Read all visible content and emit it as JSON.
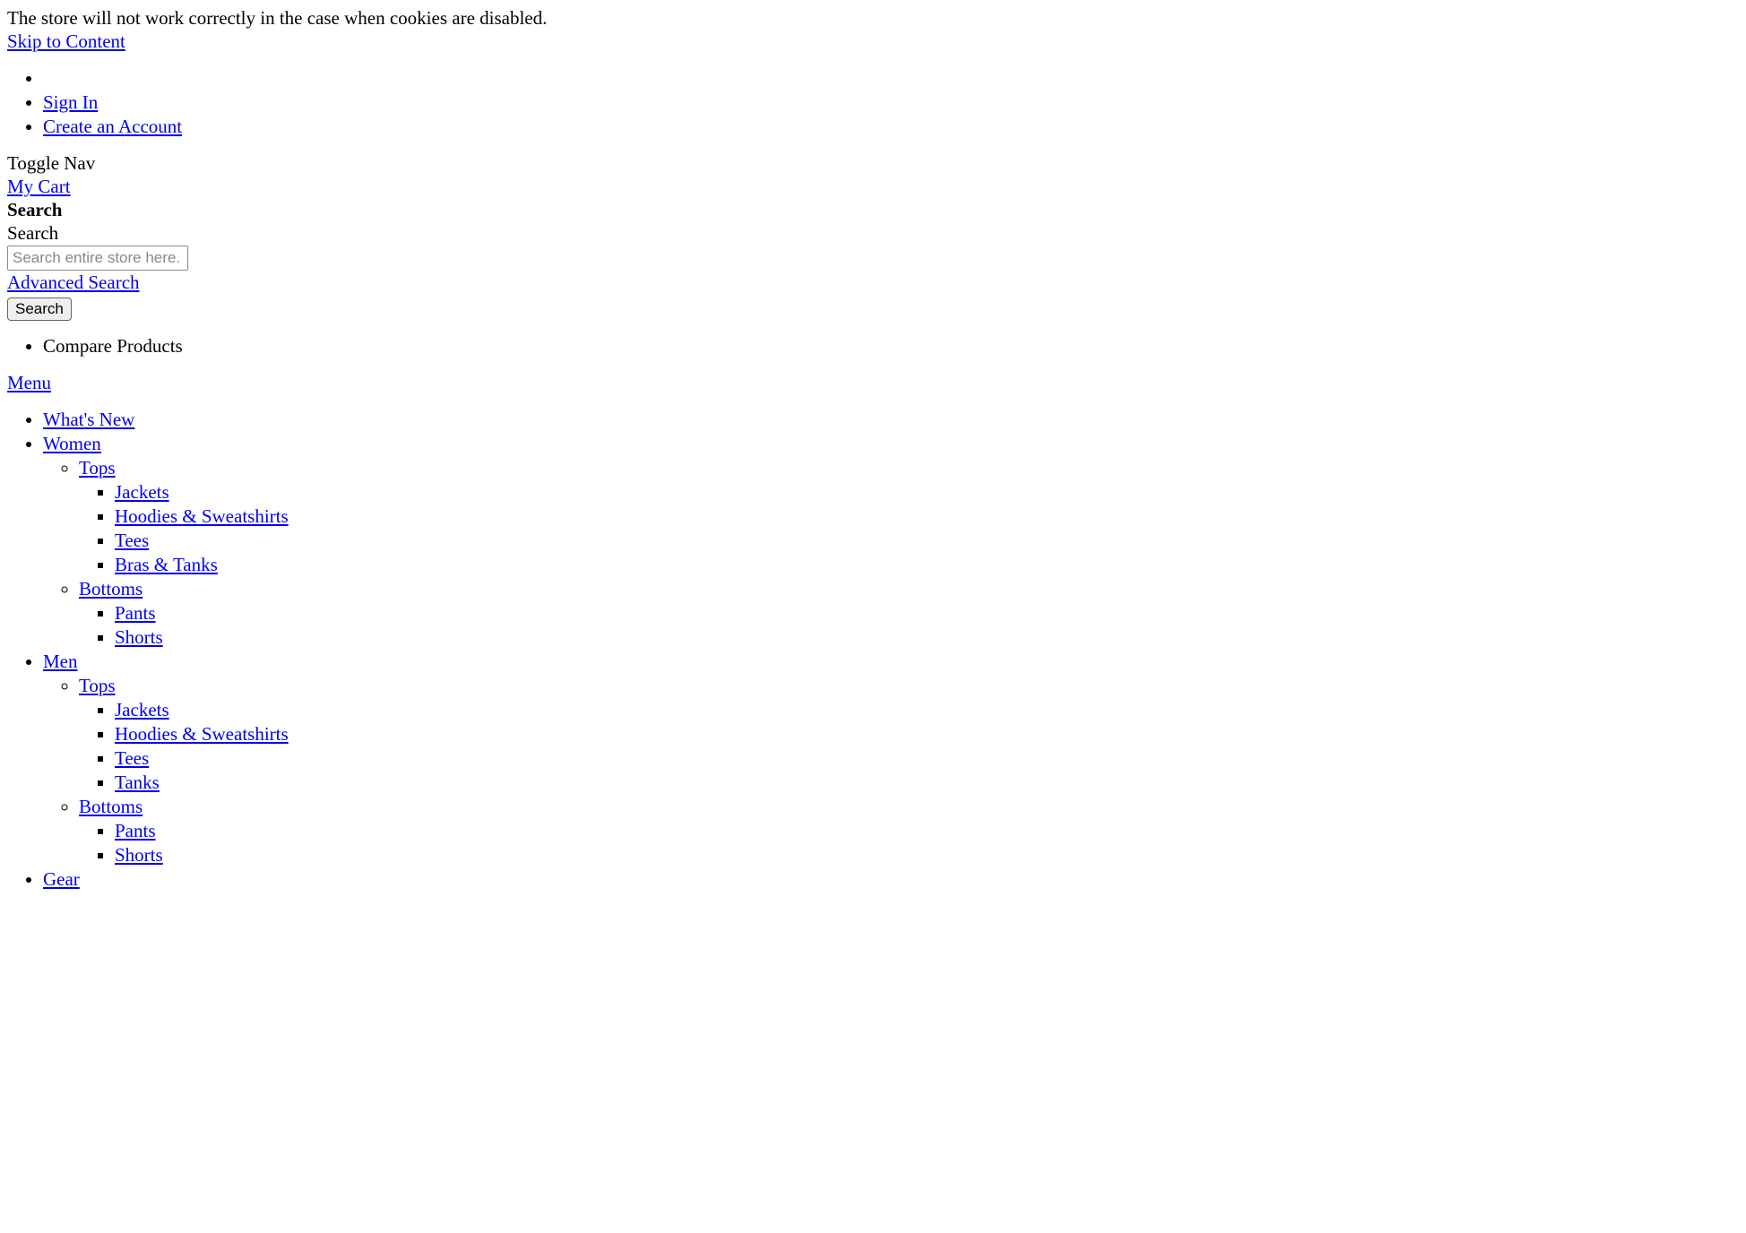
{
  "notice": "The store will not work correctly in the case when cookies are disabled.",
  "skip_link": "Skip to Content",
  "header_links": {
    "sign_in": "Sign In",
    "create_account": "Create an Account"
  },
  "toggle_nav": "Toggle Nav",
  "my_cart": "My Cart",
  "search": {
    "heading": "Search",
    "label": "Search",
    "placeholder": "Search entire store here.",
    "advanced": "Advanced Search",
    "button": "Search"
  },
  "compare": "Compare Products",
  "menu_label": "Menu",
  "nav": {
    "whats_new": "What's New",
    "women": {
      "label": "Women",
      "tops": {
        "label": "Tops",
        "jackets": "Jackets",
        "hoodies": "Hoodies & Sweatshirts",
        "tees": "Tees",
        "bras_tanks": "Bras & Tanks"
      },
      "bottoms": {
        "label": "Bottoms",
        "pants": "Pants",
        "shorts": "Shorts"
      }
    },
    "men": {
      "label": "Men",
      "tops": {
        "label": "Tops",
        "jackets": "Jackets",
        "hoodies": "Hoodies & Sweatshirts",
        "tees": "Tees",
        "tanks": "Tanks"
      },
      "bottoms": {
        "label": "Bottoms",
        "pants": "Pants",
        "shorts": "Shorts"
      }
    },
    "gear": "Gear"
  }
}
